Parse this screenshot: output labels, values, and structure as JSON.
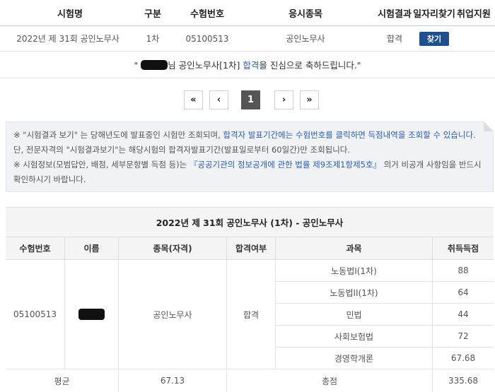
{
  "result_table": {
    "headers": [
      "시험명",
      "구분",
      "수험번호",
      "응시종목",
      "시험결과",
      "일자리찾기",
      "취업지원"
    ],
    "row": {
      "exam_name": "2022년 제 31회 공인노무사",
      "type": "1차",
      "exam_number": "05100513",
      "field": "공인노무사",
      "result": "합격",
      "find_button": "찾기"
    }
  },
  "congrats": {
    "open_quote": "\"",
    "suffix": "님 공인노무사[1차] ",
    "pass_word": "합격",
    "tail": "을 진심으로 축하드립니다.\""
  },
  "pagination": {
    "first": "«",
    "prev": "‹",
    "current": "1",
    "next": "›",
    "last": "»"
  },
  "notice": {
    "line1_a": "※ \"시험결과 보기\" 는 당해년도에 발표중인 시험만 조회되며, ",
    "line1_blue": "합격자 발표기간에는 수험번호를 클릭하면 득점내역을 조회할 수 있습니다.",
    "line1_b": " 단, 전문자격의 \"시험결과보기\"는 해당시험의 합격자발표기간(발표일로부터 60일간)만 조회됩니다.",
    "line2_a": "※ 시험정보(모범답안, 배점, 세부문항별 득점 등)는 ",
    "line2_blue": "『공공기관의 정보공개에 관한 법률 제9조제1항제5호』",
    "line2_b": " 의거 비공개 사항임을 반드시 확인하시기 바랍니다."
  },
  "detail": {
    "caption": "2022년 제 31회 공인노무사 (1차) - 공인노무사",
    "headers": [
      "수험번호",
      "이름",
      "종목(자격)",
      "합격여부",
      "과목",
      "취득득점"
    ],
    "exam_number": "05100513",
    "qualification": "공인노무사",
    "pass_status": "합격",
    "subjects": [
      {
        "name": "노동법I(1차)",
        "score": "88"
      },
      {
        "name": "노동법II(1차)",
        "score": "64"
      },
      {
        "name": "민법",
        "score": "44"
      },
      {
        "name": "사회보험법",
        "score": "72"
      },
      {
        "name": "경영학개론",
        "score": "67.68"
      }
    ],
    "average_label": "평균",
    "average_value": "67.13",
    "total_label": "총점",
    "total_value": "335.68"
  }
}
